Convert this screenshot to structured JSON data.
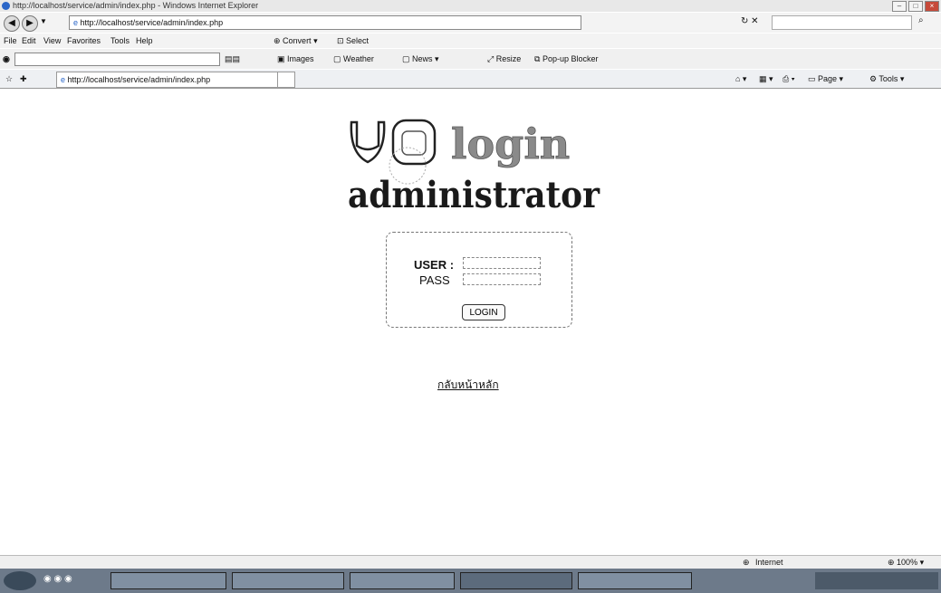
{
  "window": {
    "title": "http://localhost/service/admin/index.php - Windows Internet Explorer"
  },
  "address_bar": {
    "url": "http://localhost/service/admin/index.php"
  },
  "menu": {
    "items": [
      "File",
      "Edit",
      "View",
      "Favorites",
      "Tools",
      "Help"
    ],
    "convert": "Convert",
    "select": "Select"
  },
  "toolbar": {
    "images": "Images",
    "weather": "Weather",
    "news": "News",
    "resize": "Resize",
    "popup_blocker": "Pop-up Blocker"
  },
  "tab": {
    "title": "http://localhost/service/admin/index.php"
  },
  "commands": {
    "page": "Page",
    "tools": "Tools"
  },
  "logo": {
    "word_login": "login",
    "word_admin": "administrator"
  },
  "login_form": {
    "user_label": "USER :",
    "pass_label": "PASS",
    "button_label": "LOGIN"
  },
  "home_link": "กลับหน้าหลัก",
  "status_bar": {
    "zone": "Internet",
    "zoom": "100%"
  },
  "colors": {
    "logo_gray": "#8a8a8a",
    "logo_dark": "#1a1a1a",
    "taskbar": "#6d7a8a"
  }
}
